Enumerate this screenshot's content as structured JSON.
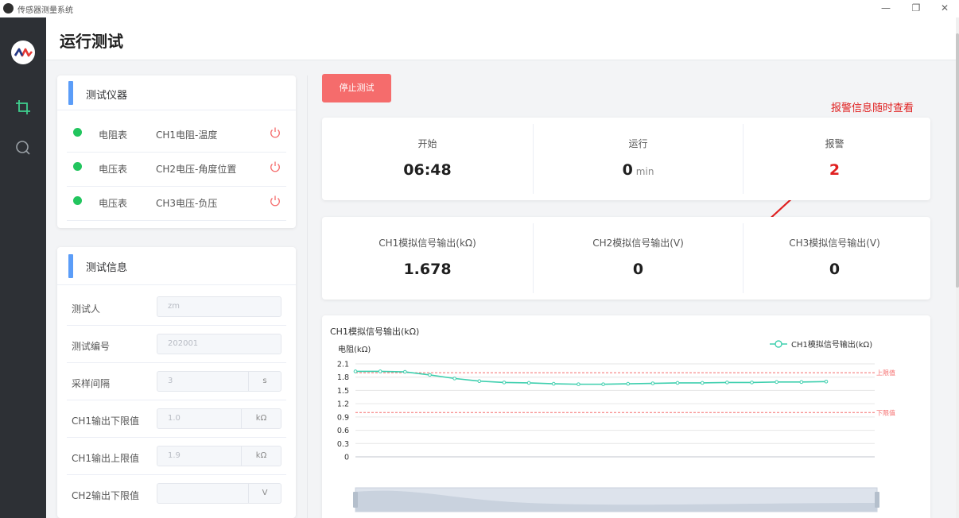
{
  "window": {
    "title": "传感器测量系统",
    "minimize": "—",
    "restore": "❐",
    "close": "✕"
  },
  "nav": {
    "items": [
      {
        "name": "crop-icon",
        "color": "#3ecf8e"
      },
      {
        "name": "search-icon",
        "color": "#9aa0a6"
      }
    ]
  },
  "header": {
    "title": "运行测试"
  },
  "instruments": {
    "title": "测试仪器",
    "rows": [
      {
        "type": "电阻表",
        "name": "CH1电阻-温度"
      },
      {
        "type": "电压表",
        "name": "CH2电压-角度位置"
      },
      {
        "type": "电压表",
        "name": "CH3电压-负压"
      }
    ],
    "status_color": "#22c55e",
    "power_color": "#f56c6c"
  },
  "test_info": {
    "title": "测试信息",
    "fields": [
      {
        "label": "测试人",
        "value": "zm",
        "unit": ""
      },
      {
        "label": "测试编号",
        "value": "202001",
        "unit": ""
      },
      {
        "label": "采样间隔",
        "value": "3",
        "unit": "s"
      },
      {
        "label": "CH1输出下限值",
        "value": "1.0",
        "unit": "kΩ"
      },
      {
        "label": "CH1输出上限值",
        "value": "1.9",
        "unit": "kΩ"
      },
      {
        "label": "CH2输出下限值",
        "value": "",
        "unit": "V"
      }
    ]
  },
  "controls": {
    "stop_label": "停止测试",
    "stop_color": "#f56c6c"
  },
  "annotation": {
    "text": "报警信息随时查看",
    "color": "#e02020"
  },
  "status": {
    "start": {
      "label": "开始",
      "value": "06:48"
    },
    "run": {
      "label": "运行",
      "value": "0",
      "unit": "min"
    },
    "alarm": {
      "label": "报警",
      "value": "2",
      "color": "#e02020"
    }
  },
  "outputs": {
    "ch1": {
      "label": "CH1模拟信号输出(kΩ)",
      "value": "1.678"
    },
    "ch2": {
      "label": "CH2模拟信号输出(V)",
      "value": "0"
    },
    "ch3": {
      "label": "CH3模拟信号输出(V)",
      "value": "0"
    }
  },
  "chart_data": {
    "type": "line",
    "title": "CH1模拟信号输出(kΩ)",
    "ylabel": "电阻(kΩ)",
    "yticks": [
      "2.1",
      "1.8",
      "1.5",
      "1.2",
      "0.9",
      "0.6",
      "0.3",
      "0"
    ],
    "ylim": [
      0,
      2.1
    ],
    "series": [
      {
        "name": "CH1模拟信号输出(kΩ)",
        "color": "#3ecfae",
        "values": [
          1.93,
          1.93,
          1.92,
          1.85,
          1.77,
          1.71,
          1.68,
          1.67,
          1.65,
          1.64,
          1.64,
          1.65,
          1.66,
          1.67,
          1.67,
          1.68,
          1.68,
          1.69,
          1.69,
          1.7
        ]
      }
    ],
    "markLines": [
      {
        "label": "上限值",
        "value": 1.9,
        "color": "#f56c6c"
      },
      {
        "label": "下限值",
        "value": 1.0,
        "color": "#f56c6c"
      }
    ],
    "legend": "top-right",
    "grid": true
  }
}
